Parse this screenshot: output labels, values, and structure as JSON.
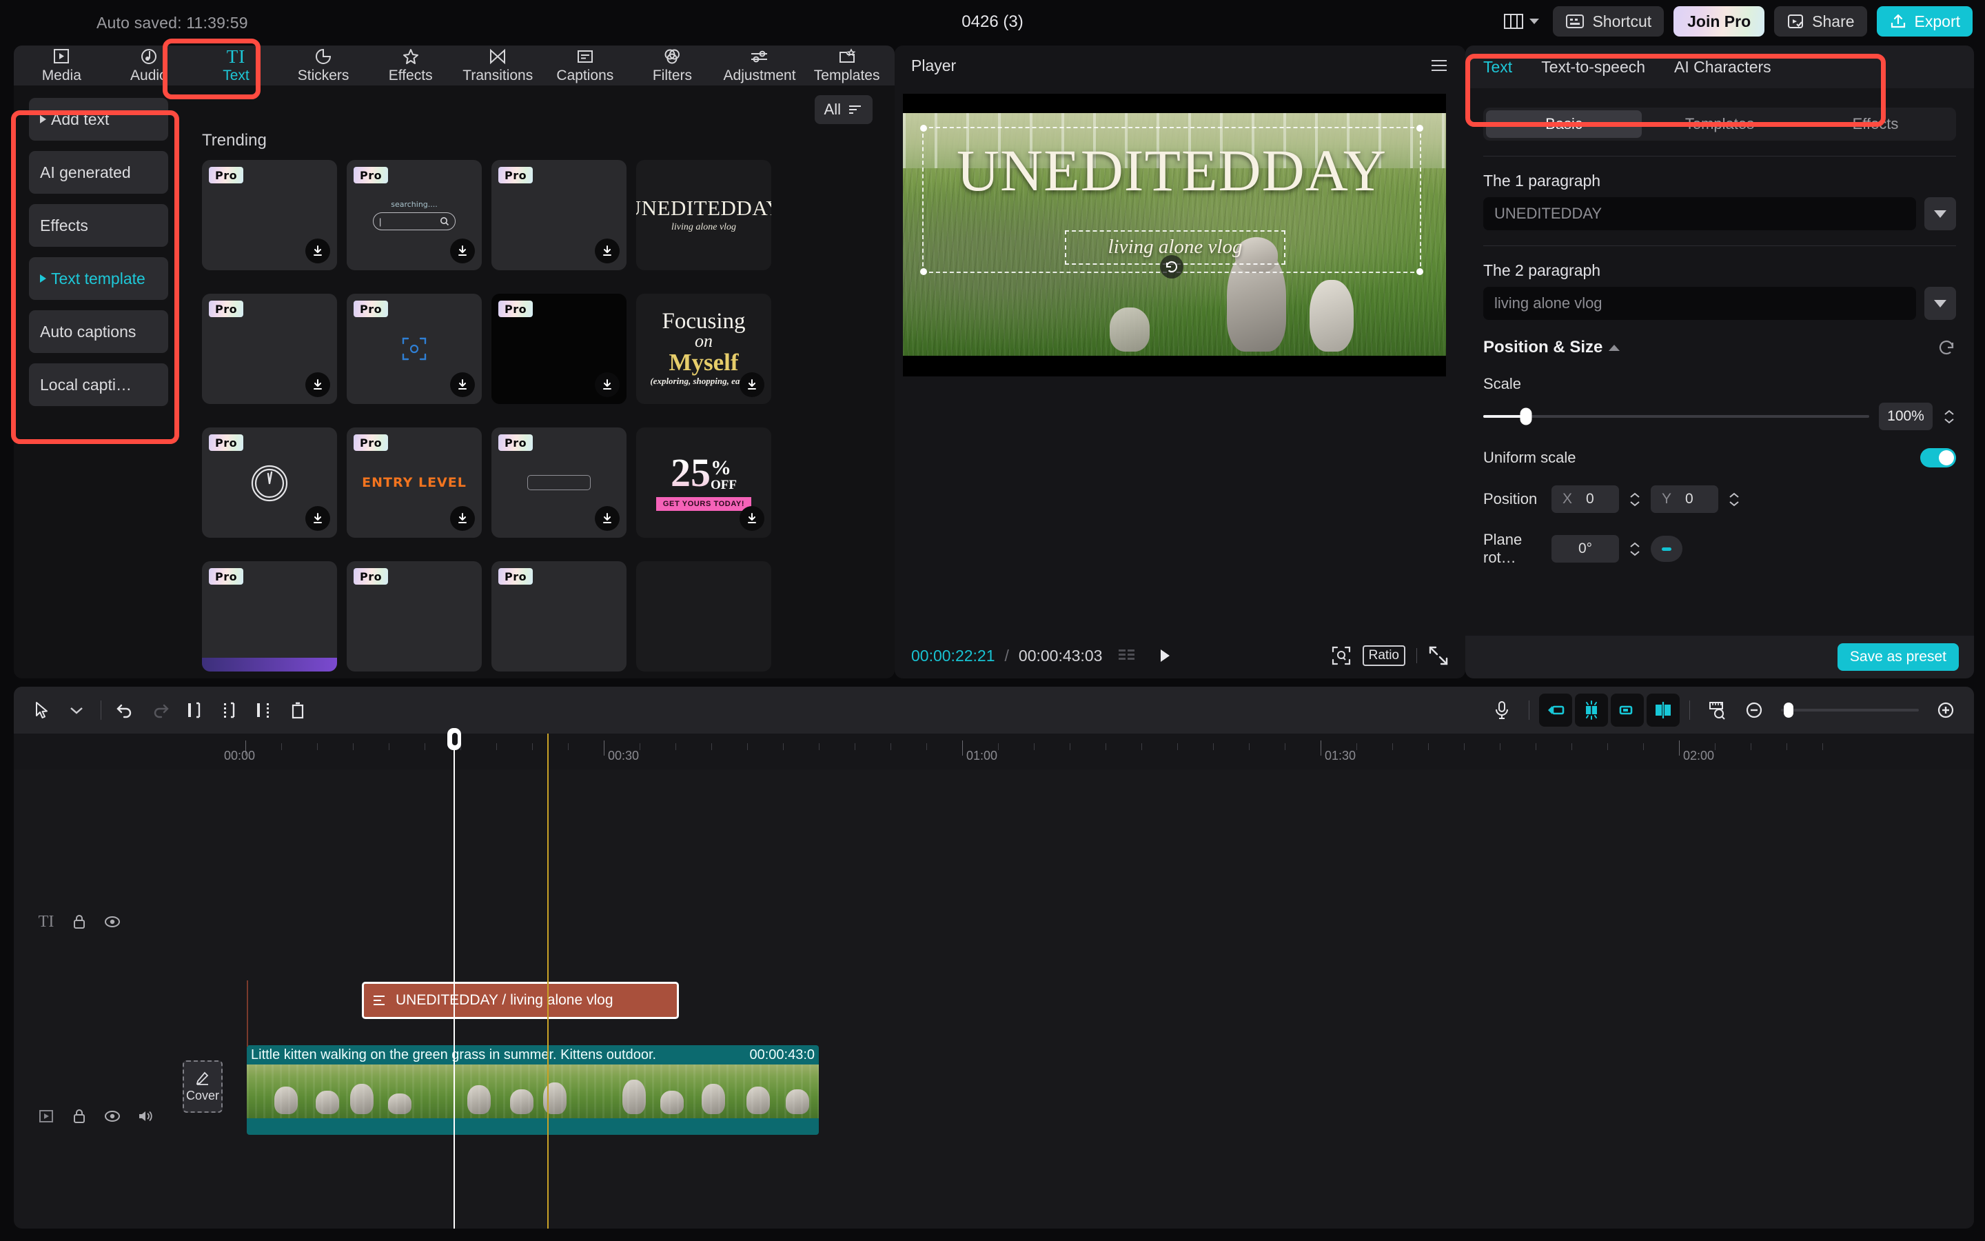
{
  "topbar": {
    "autosave": "Auto saved: 11:39:59",
    "project_title": "0426 (3)",
    "layout_icon": "layout-icon",
    "shortcut_label": "Shortcut",
    "join_pro_label": "Join Pro",
    "share_label": "Share",
    "export_label": "Export",
    "accent_color": "#12c4d4"
  },
  "tool_tabs": [
    {
      "label": "Media",
      "icon": "media-icon",
      "active": false
    },
    {
      "label": "Audio",
      "icon": "audio-icon",
      "active": false
    },
    {
      "label": "Text",
      "icon": "text-icon",
      "active": true
    },
    {
      "label": "Stickers",
      "icon": "sticker-icon",
      "active": false
    },
    {
      "label": "Effects",
      "icon": "effects-icon",
      "active": false
    },
    {
      "label": "Transitions",
      "icon": "transitions-icon",
      "active": false
    },
    {
      "label": "Captions",
      "icon": "captions-icon",
      "active": false
    },
    {
      "label": "Filters",
      "icon": "filters-icon",
      "active": false
    },
    {
      "label": "Adjustment",
      "icon": "adjustment-icon",
      "active": false
    },
    {
      "label": "Templates",
      "icon": "templates-icon",
      "active": false
    }
  ],
  "sidebar": {
    "items": [
      {
        "label": "Add text",
        "arrow": true,
        "active": false
      },
      {
        "label": "AI generated",
        "arrow": false,
        "active": false
      },
      {
        "label": "Effects",
        "arrow": false,
        "active": false
      },
      {
        "label": "Text template",
        "arrow": true,
        "active": true
      },
      {
        "label": "Auto captions",
        "arrow": false,
        "active": false
      },
      {
        "label": "Local capti…",
        "arrow": false,
        "active": false
      }
    ]
  },
  "library": {
    "filter_label": "All",
    "filter_icon": "filter-icon",
    "section_title": "Trending",
    "pro_badge": "Pro",
    "download_icon": "download-icon",
    "cards": [
      {
        "kind": "blank",
        "pro": true,
        "download": true
      },
      {
        "kind": "search",
        "pro": true,
        "download": true,
        "text": "searching...."
      },
      {
        "kind": "blank",
        "pro": true,
        "download": true
      },
      {
        "kind": "uneditedday",
        "pro": false,
        "download": false,
        "title": "UNEDITEDDAY",
        "subtitle": "living alone vlog"
      },
      {
        "kind": "blank",
        "pro": true,
        "download": true
      },
      {
        "kind": "frame",
        "pro": true,
        "download": true
      },
      {
        "kind": "black",
        "pro": true,
        "download": true
      },
      {
        "kind": "focusing",
        "pro": false,
        "download": true,
        "line1": "Focusing",
        "line2": "on",
        "line3": "Myself",
        "line4": "(exploring, shopping, eating)"
      },
      {
        "kind": "clock",
        "pro": true,
        "download": true
      },
      {
        "kind": "entry",
        "pro": true,
        "download": true,
        "text": "ENTRY LEVEL"
      },
      {
        "kind": "pill",
        "pro": true,
        "download": true
      },
      {
        "kind": "off25",
        "pro": false,
        "download": true,
        "num": "25",
        "pct": "%",
        "off": "OFF",
        "cta": "GET YOURS TODAY!"
      },
      {
        "kind": "blank",
        "pro": true,
        "download": false
      },
      {
        "kind": "blank",
        "pro": true,
        "download": false
      },
      {
        "kind": "blank",
        "pro": true,
        "download": false
      },
      {
        "kind": "blank",
        "pro": false,
        "download": false
      }
    ]
  },
  "player": {
    "title": "Player",
    "menu_icon": "hamburger-icon",
    "overlay_title": "UNEDITEDDAY",
    "overlay_subtitle": "living alone vlog",
    "current_time": "00:00:22:21",
    "time_separator": "/",
    "total_time": "00:00:43:03",
    "markers_icon": "markers-icon",
    "play_icon": "play-icon",
    "crop_icon": "crop-icon",
    "ratio_label": "Ratio",
    "fullscreen_icon": "fullscreen-icon",
    "rotate_icon": "rotate-icon"
  },
  "inspector": {
    "tabs": [
      {
        "label": "Text",
        "active": true
      },
      {
        "label": "Text-to-speech",
        "active": false
      },
      {
        "label": "AI Characters",
        "active": false
      }
    ],
    "segments": [
      {
        "label": "Basic",
        "active": true
      },
      {
        "label": "Templates",
        "active": false
      },
      {
        "label": "Effects",
        "active": false
      }
    ],
    "paragraph1": {
      "label": "The 1 paragraph",
      "value": "UNEDITEDDAY"
    },
    "paragraph2": {
      "label": "The 2 paragraph",
      "value": "living alone vlog"
    },
    "position_size": {
      "title": "Position & Size",
      "reset_icon": "reset-icon",
      "scale_label": "Scale",
      "scale_value": "100%",
      "uniform_label": "Uniform scale",
      "uniform_on": true,
      "position_label": "Position",
      "x_axis": "X",
      "x_value": "0",
      "y_axis": "Y",
      "y_value": "0",
      "rotation_label": "Plane rot…",
      "rotation_value": "0°"
    },
    "save_preset_label": "Save as preset"
  },
  "timeline": {
    "tools": [
      {
        "name": "select-tool-icon"
      },
      {
        "name": "chevron-down-icon"
      },
      {
        "name": "undo-icon"
      },
      {
        "name": "redo-icon"
      },
      {
        "name": "split-icon"
      },
      {
        "name": "trim-left-icon"
      },
      {
        "name": "trim-right-icon"
      },
      {
        "name": "delete-icon"
      }
    ],
    "right_tools": [
      {
        "name": "microphone-icon"
      },
      {
        "name": "snap-left-icon"
      },
      {
        "name": "auto-snap-icon"
      },
      {
        "name": "snap-right-icon"
      },
      {
        "name": "align-center-icon"
      },
      {
        "name": "ruler-icon"
      },
      {
        "name": "zoom-out-icon"
      },
      {
        "name": "zoom-in-icon"
      }
    ],
    "ruler_labels": [
      "00:00",
      "00:30",
      "01:00",
      "01:30",
      "02:00"
    ],
    "track_headers": [
      {
        "type_icon": "text-track-icon",
        "lock_icon": "lock-icon",
        "eye_icon": "eye-icon",
        "mute_icon": null
      },
      {
        "type_icon": "video-track-icon",
        "lock_icon": "lock-icon",
        "eye_icon": "eye-icon",
        "mute_icon": "speaker-icon"
      }
    ],
    "text_clip": {
      "label": "UNEDITEDDAY / living alone vlog",
      "icon": "text-clip-icon",
      "color": "#a9503c"
    },
    "video_clip": {
      "label": "Little kitten walking on the green grass in summer. Kittens outdoor.",
      "duration": "00:00:43:0",
      "color": "#0c6a6f"
    },
    "cover_button": {
      "label": "Cover",
      "icon": "pencil-icon"
    }
  }
}
